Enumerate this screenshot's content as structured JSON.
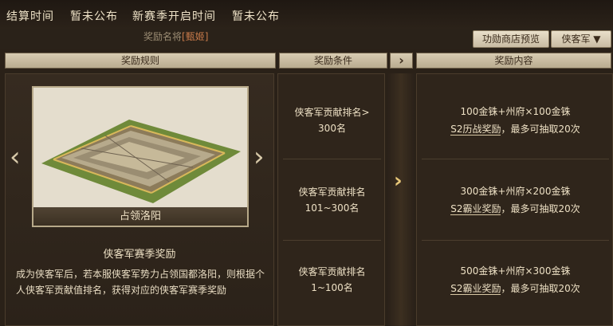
{
  "header": {
    "settle_label": "结算时间",
    "settle_value": "暂未公布",
    "new_season_label": "新赛季开启时间",
    "new_season_value": "暂未公布"
  },
  "subheader": {
    "note_prefix": "奖励名将",
    "note_suffix": "[甄姬]",
    "shop_preview_label": "功勋商店预览",
    "faction_select": "侠客军",
    "faction_chevron": "▼"
  },
  "columns": {
    "rules": "奖励规则",
    "conditions": "奖励条件",
    "arrow": "›",
    "contents": "奖励内容"
  },
  "left": {
    "card_caption": "占领洛阳",
    "prev_arrow": "‹",
    "next_arrow": "›",
    "season_title": "侠客军赛季奖励",
    "description": "成为侠客军后，若本服侠客军势力占领国都洛阳，则根据个人侠客军贡献值排名，获得对应的侠客军赛季奖励"
  },
  "middle_arrow": "›",
  "rows": [
    {
      "condition_line1": "侠客军贡献排名>",
      "condition_line2": "300名",
      "reward_line1": "100金铢+州府×100金铢",
      "reward_link": "S2历战奖励",
      "reward_tail": "，最多可抽取20次"
    },
    {
      "condition_line1": "侠客军贡献排名",
      "condition_line2": "101~300名",
      "reward_line1": "300金铢+州府×200金铢",
      "reward_link": "S2霸业奖励",
      "reward_tail": "，最多可抽取20次"
    },
    {
      "condition_line1": "侠客军贡献排名",
      "condition_line2": "1~100名",
      "reward_line1": "500金铢+州府×300金铢",
      "reward_link": "S2霸业奖励",
      "reward_tail": "，最多可抽取20次"
    }
  ],
  "colors": {
    "panel_bg": "#2f251b",
    "tab_bg": "#d8ccb2",
    "accent_text": "#c87a4a"
  }
}
